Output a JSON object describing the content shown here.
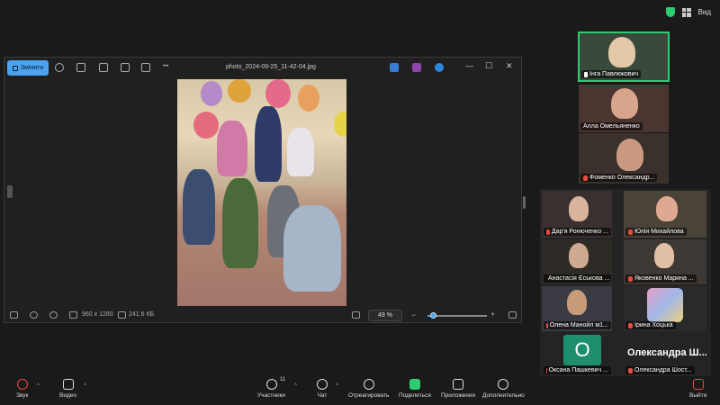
{
  "top": {
    "view_label": "Вид"
  },
  "viewer": {
    "edit_label": "Змінити",
    "file_name": "photo_2024-09-25_11-42-04.jpg",
    "more_glyph": "•••",
    "min_glyph": "—",
    "max_glyph": "☐",
    "close_glyph": "✕",
    "resolution": "960 x 1280",
    "file_size": "241.6 КБ",
    "zoom": "49 %",
    "zoom_minus": "−",
    "zoom_plus": "+",
    "zoom_fraction": 0.09
  },
  "participants": [
    {
      "name": "Інга Павлюкович",
      "speaking": true,
      "pinned": true
    },
    {
      "name": "Алла Омельяненко",
      "speaking": false
    },
    {
      "name": "Фоменко Олександр...",
      "speaking": false
    },
    {
      "name": "Дар'я Ронюченко ...",
      "speaking": false
    },
    {
      "name": "Юлія Михайлова",
      "speaking": false
    },
    {
      "name": "Анастасія Єськова ...",
      "speaking": false
    },
    {
      "name": "Яковенко Марина ...",
      "speaking": false
    },
    {
      "name": "Олена Манойл м1...",
      "speaking": false
    },
    {
      "name": "Ірина Хоцька",
      "speaking": false
    },
    {
      "name": "Оксана Пашкевич ...",
      "speaking": false,
      "avatar_letter": "О"
    },
    {
      "name": "Олександра Шост...",
      "speaking": false,
      "display_name": "Олександра Ш..."
    }
  ],
  "toolbar": {
    "audio": "Звук",
    "video": "Видео",
    "participants": "Участники",
    "participants_count": "11",
    "chat": "Чат",
    "react": "Отреагировать",
    "share": "Поделиться",
    "apps": "Приложения",
    "more": "Дополнительно",
    "leave": "Выйти",
    "caret": "^"
  }
}
